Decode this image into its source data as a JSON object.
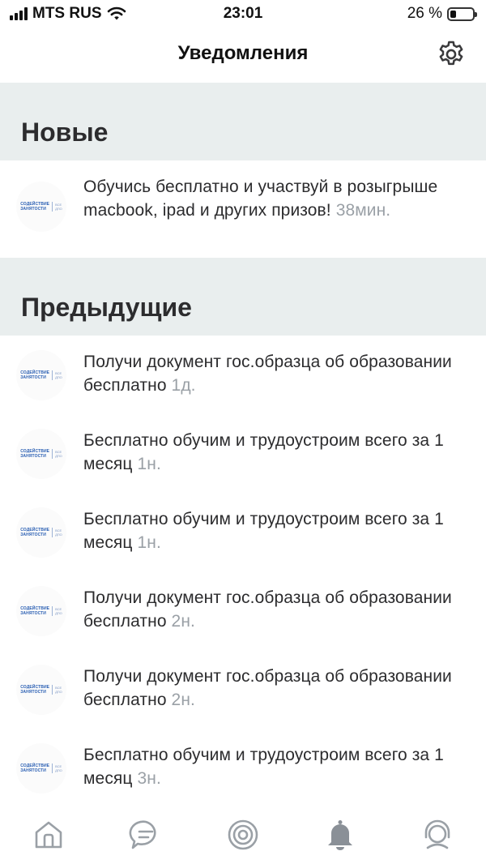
{
  "status_bar": {
    "carrier": "MTS RUS",
    "time": "23:01",
    "battery_text": "26 %",
    "battery_level": 0.26
  },
  "header": {
    "title": "Уведомления",
    "settings_icon": "gear-icon"
  },
  "sections": {
    "new_title": "Новые",
    "previous_title": "Предыдущие"
  },
  "logo": {
    "main_line1": "СОДЕЙСТВИЕ",
    "main_line2": "ЗАНЯТОСТИ",
    "side_line1": "ВСЕ",
    "side_line2": "ДПО",
    "color": "#2a5fb3"
  },
  "notifications_new": [
    {
      "text": "Обучись бесплатно и участвуй в розыгрыше macbook, ipad и других призов!",
      "time": "38мин."
    }
  ],
  "notifications_previous": [
    {
      "text": "Получи документ гос.образца об образовании бесплатно",
      "time": "1д."
    },
    {
      "text": "Бесплатно обучим и трудоустроим всего за 1 месяц",
      "time": "1н."
    },
    {
      "text": "Бесплатно обучим и трудоустроим всего за 1 месяц",
      "time": "1н."
    },
    {
      "text": "Получи документ гос.образца об образовании бесплатно",
      "time": "2н."
    },
    {
      "text": "Получи документ гос.образца об образовании бесплатно",
      "time": "2н."
    },
    {
      "text": "Бесплатно обучим и трудоустроим всего за 1 месяц",
      "time": "3н."
    }
  ],
  "tab_bar": {
    "tabs": [
      {
        "icon": "home-icon",
        "active": false
      },
      {
        "icon": "chat-icon",
        "active": false
      },
      {
        "icon": "target-icon",
        "active": false
      },
      {
        "icon": "bell-icon",
        "active": true
      },
      {
        "icon": "support-icon",
        "active": false
      }
    ],
    "active_color": "#8a9097",
    "inactive_color": "#9aa0a6"
  }
}
